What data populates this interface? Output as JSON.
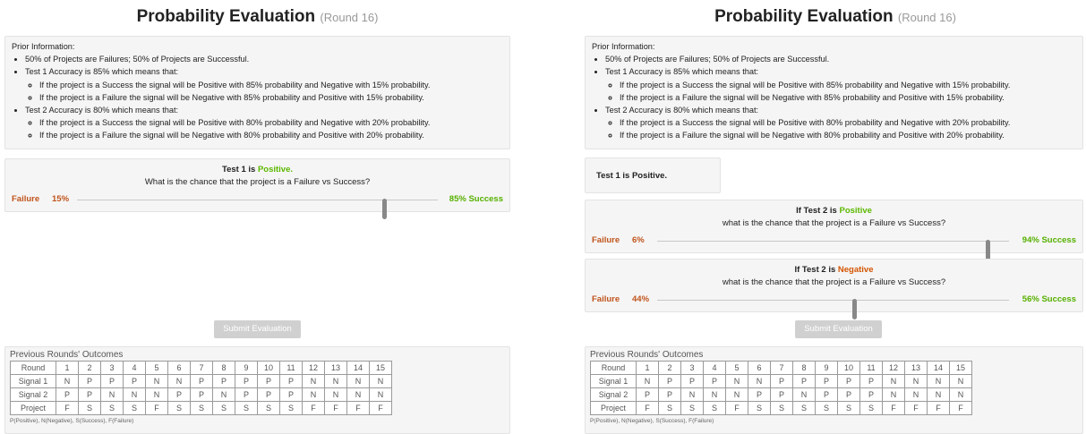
{
  "title": "Probability Evaluation",
  "round": "(Round 16)",
  "prior": {
    "heading": "Prior Information:",
    "base": "50% of Projects are Failures; 50% of Projects are Successful.",
    "test1": "Test 1 Accuracy is 85% which means that:",
    "test1_a": "If the project is a Success the signal will be Positive with 85% probability and Negative with 15% probability.",
    "test1_b": "If the project is a Failure the signal will be Negative with 85% probability and Positive with 15% probability.",
    "test2": "Test 2 Accuracy is 80% which means that:",
    "test2_a": "If the project is a Success the signal will be Positive with 80% probability and Negative with 20% probability.",
    "test2_b": "If the project is a Failure the signal will be Negative with 80% probability and Positive with 20% probability."
  },
  "left": {
    "test_prefix": "Test 1 is ",
    "test_result": "Positive.",
    "question": "What is the chance that the project is a Failure vs Success?",
    "failure_label": "Failure",
    "failure_value": "15%",
    "success_value": "85%",
    "success_label": "Success",
    "slider_success_fraction": 0.85
  },
  "right": {
    "test1_text": "Test 1 is Positive.",
    "q1_prefix": "If Test 2 is ",
    "q1_result": "Positive",
    "q1_question": "what is the chance that the project is a Failure vs Success?",
    "q1_failure_value": "6%",
    "q1_success_value": "94%",
    "q1_slider_success_fraction": 0.94,
    "q2_prefix": "If Test 2 is ",
    "q2_result": "Negative",
    "q2_question": "what is the chance that the project is a Failure vs Success?",
    "q2_failure_value": "44%",
    "q2_success_value": "56%",
    "q2_slider_success_fraction": 0.56,
    "failure_label": "Failure",
    "success_label": "Success"
  },
  "submit_label": "Submit Evaluation",
  "previous": {
    "title": "Previous Rounds' Outcomes",
    "rows": [
      [
        "Round",
        "1",
        "2",
        "3",
        "4",
        "5",
        "6",
        "7",
        "8",
        "9",
        "10",
        "11",
        "12",
        "13",
        "14",
        "15"
      ],
      [
        "Signal 1",
        "N",
        "P",
        "P",
        "P",
        "N",
        "N",
        "P",
        "P",
        "P",
        "P",
        "P",
        "N",
        "N",
        "N",
        "N"
      ],
      [
        "Signal 2",
        "P",
        "P",
        "N",
        "N",
        "N",
        "P",
        "P",
        "N",
        "P",
        "P",
        "P",
        "N",
        "N",
        "N",
        "N"
      ],
      [
        "Project",
        "F",
        "S",
        "S",
        "S",
        "F",
        "S",
        "S",
        "S",
        "S",
        "S",
        "S",
        "F",
        "F",
        "F",
        "F"
      ]
    ],
    "legend": "P(Positive), N(Negative), S(Success), F(Failure)"
  },
  "colors": {
    "failure": "#c0541c",
    "success": "#56b000",
    "positive": "#5cb800",
    "negative": "#d35400"
  }
}
